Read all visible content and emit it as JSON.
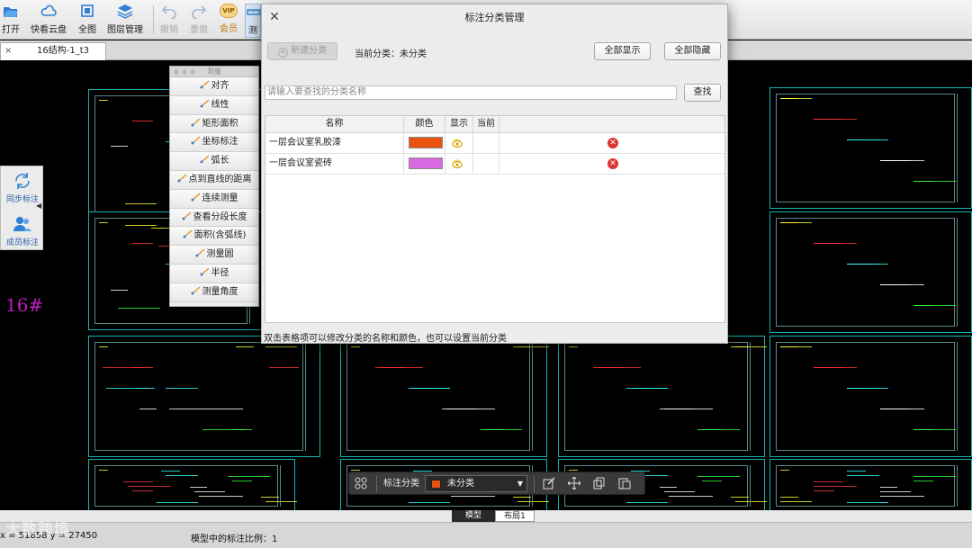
{
  "toolbar": {
    "items": [
      {
        "label": "打开",
        "icon": "folder-open-icon"
      },
      {
        "label": "快看云盘",
        "icon": "cloud-icon"
      },
      {
        "label": "全图",
        "icon": "fit-view-icon"
      },
      {
        "label": "图层管理",
        "icon": "layers-icon"
      },
      {
        "label": "撤销",
        "icon": "undo-icon"
      },
      {
        "label": "重做",
        "icon": "redo-icon"
      },
      {
        "label": "会员",
        "icon": "vip-icon"
      },
      {
        "label": "测",
        "icon": "measure-icon"
      }
    ],
    "vip_badge": "VIP"
  },
  "tabs": {
    "close": "×",
    "active": "16结构-1_t3"
  },
  "side_panel": {
    "sync_label": "同步标注",
    "member_label": "成员标注",
    "collapse": "◀"
  },
  "canvas_label": "16#",
  "measure_panel": {
    "title": "测量",
    "items": [
      "对齐",
      "线性",
      "矩形面积",
      "坐标标注",
      "弧长",
      "点到直线的距离",
      "连续测量",
      "查看分段长度",
      "面积(含弧线)",
      "测量圆",
      "半径",
      "测量角度"
    ]
  },
  "dialog": {
    "title": "标注分类管理",
    "close": "✕",
    "new_button": "新建分类",
    "current_label": "当前分类：",
    "current_value": "未分类",
    "show_all": "全部显示",
    "hide_all": "全部隐藏",
    "search_placeholder": "请输入要查找的分类名称",
    "search_button": "查找",
    "columns": [
      "名称",
      "颜色",
      "显示",
      "当前"
    ],
    "rows": [
      {
        "name": "一层会议室乳胶漆",
        "color": "#e85410"
      },
      {
        "name": "一层会议室瓷砖",
        "color": "#d86ae2"
      }
    ],
    "hint": "双击表格项可以修改分类的名称和颜色，也可以设置当前分类"
  },
  "bottom_toolbar": {
    "label": "标注分类",
    "selected": "未分类",
    "selected_color": "#e85410"
  },
  "layout_tabs": [
    "模型",
    "布局1"
  ],
  "status": {
    "coords": "x = 51858 y = 27450",
    "scale_text": "模型中的标注比例：1"
  },
  "watermark": "大数跨境"
}
